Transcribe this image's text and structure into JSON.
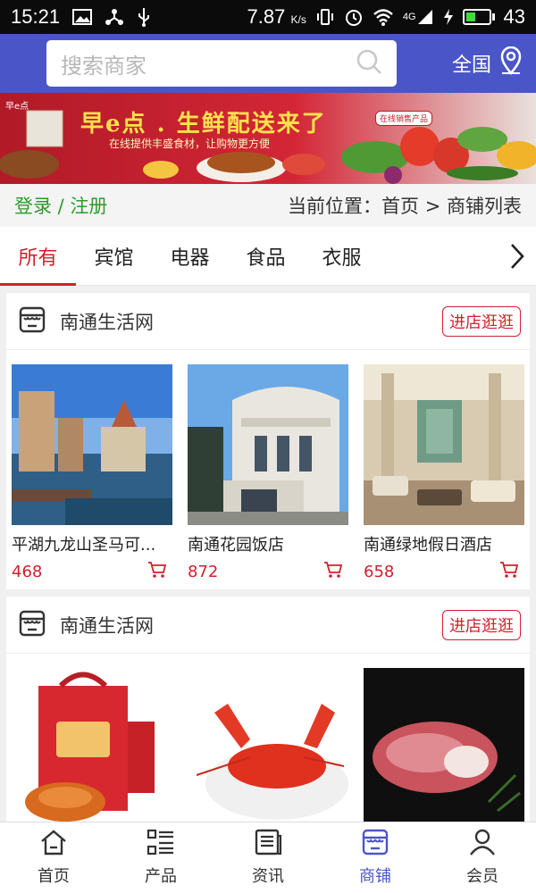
{
  "status_bar": {
    "time": "15:21",
    "speed_value": "7.87",
    "speed_unit": "K/s",
    "network": "4G",
    "battery": "43",
    "battery_level": 0.43
  },
  "header": {
    "search_placeholder": "搜索商家",
    "region_label": "全国"
  },
  "banner": {
    "brand": "早e点",
    "title": "早e点 . 生鲜配送来了",
    "subtitle": "在线提供丰盛食材，让购物更方便",
    "tag": "在线销售产品"
  },
  "location_bar": {
    "login_label": "登录 / 注册",
    "path_label": "当前位置：首页 > 商铺列表"
  },
  "category_tabs": [
    {
      "label": "所有",
      "active": true
    },
    {
      "label": "宾馆",
      "active": false
    },
    {
      "label": "电器",
      "active": false
    },
    {
      "label": "食品",
      "active": false
    },
    {
      "label": "衣服",
      "active": false
    }
  ],
  "shops": [
    {
      "name": "南通生活网",
      "enter_label": "进店逛逛",
      "products": [
        {
          "title": "平湖九龙山圣马可...",
          "price": "468"
        },
        {
          "title": "南通花园饭店",
          "price": "872"
        },
        {
          "title": "南通绿地假日酒店",
          "price": "658"
        }
      ]
    },
    {
      "name": "南通生活网",
      "enter_label": "进店逛逛",
      "products": [
        {
          "title": "",
          "price": ""
        },
        {
          "title": "",
          "price": ""
        },
        {
          "title": "",
          "price": ""
        }
      ]
    }
  ],
  "bottom_nav": [
    {
      "label": "首页",
      "icon": "home-icon",
      "active": false
    },
    {
      "label": "产品",
      "icon": "list-icon",
      "active": false
    },
    {
      "label": "资讯",
      "icon": "news-icon",
      "active": false
    },
    {
      "label": "商铺",
      "icon": "shop-icon",
      "active": true
    },
    {
      "label": "会员",
      "icon": "user-icon",
      "active": false
    }
  ],
  "colors": {
    "header_blue": "#4a56c8",
    "accent_red": "#d0202e",
    "login_green": "#2d9a2d"
  }
}
